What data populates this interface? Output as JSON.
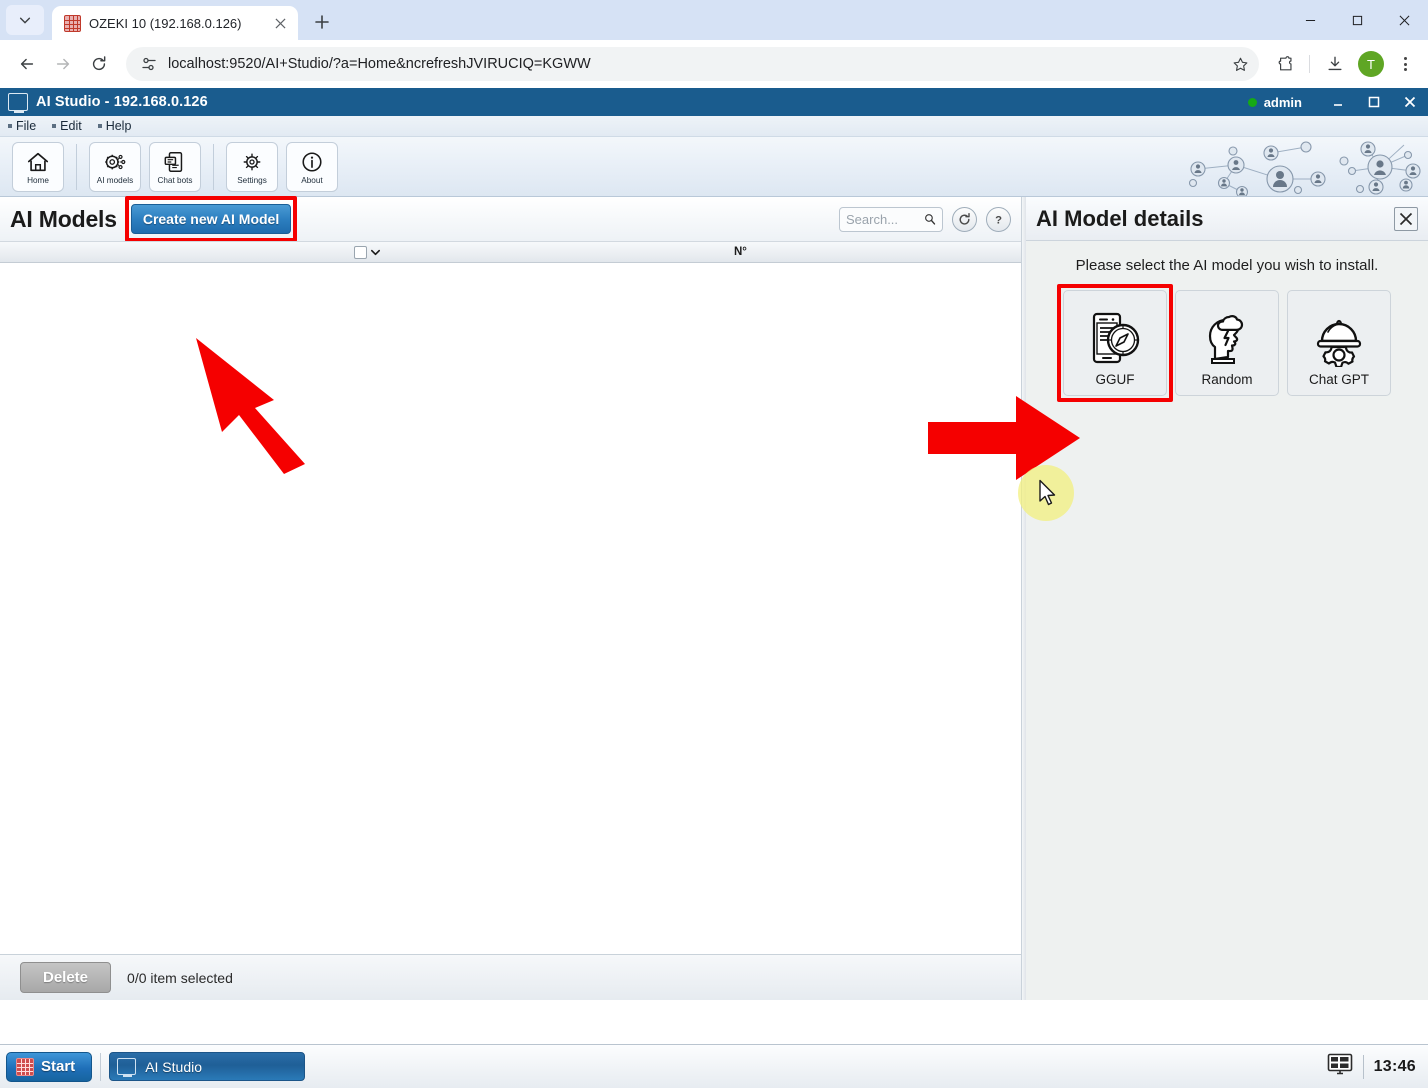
{
  "browser": {
    "tab": {
      "title": "OZEKI 10 (192.168.0.126)",
      "favicon": "ozeki-grid-icon",
      "close": "×"
    },
    "new_tab_label": "+",
    "url": "localhost:9520/AI+Studio/?a=Home&ncrefreshJVIRUCIQ=KGWW",
    "profile_initial": "T",
    "window_controls": {
      "minimize": "—",
      "maximize": "□",
      "close": "✕"
    }
  },
  "app": {
    "title": "AI Studio - 192.168.0.126",
    "user": "admin",
    "menu": [
      {
        "label": "File"
      },
      {
        "label": "Edit"
      },
      {
        "label": "Help"
      }
    ],
    "ribbon": [
      {
        "label": "Home",
        "icon": "home-icon"
      },
      {
        "label": "AI models",
        "icon": "gears-ai-icon"
      },
      {
        "label": "Chat bots",
        "icon": "chatbot-icon"
      },
      {
        "label": "Settings",
        "icon": "gear-icon"
      },
      {
        "label": "About",
        "icon": "info-icon"
      }
    ]
  },
  "left_panel": {
    "title": "AI Models",
    "create_button": "Create new AI Model",
    "search_placeholder": "Search...",
    "search_value": "",
    "refresh_icon": "refresh-icon",
    "help_icon": "question-mark-icon",
    "table": {
      "columns": [
        "",
        "N°"
      ],
      "rows": []
    },
    "footer": {
      "delete_button": "Delete",
      "selection_status": "0/0 item selected"
    }
  },
  "right_panel": {
    "title": "AI Model details",
    "close_label": "X",
    "instruction": "Please select the AI model you wish to install.",
    "cards": [
      {
        "label": "GGUF",
        "icon": "phone-compass-icon",
        "highlighted": true
      },
      {
        "label": "Random",
        "icon": "head-cloud-icon",
        "highlighted": false
      },
      {
        "label": "Chat GPT",
        "icon": "helmet-gear-icon",
        "highlighted": false
      }
    ]
  },
  "taskbar": {
    "start_label": "Start",
    "items": [
      {
        "label": "AI Studio",
        "icon": "ai-studio-icon"
      }
    ],
    "tray_icon": "display-icon",
    "clock": "13:46"
  },
  "colors": {
    "accent_blue": "#1f6cad",
    "title_bar": "#1a5c8e",
    "highlight_red": "#f50000",
    "cursor_highlight": "#f2f07a",
    "status_green": "#16a916"
  }
}
